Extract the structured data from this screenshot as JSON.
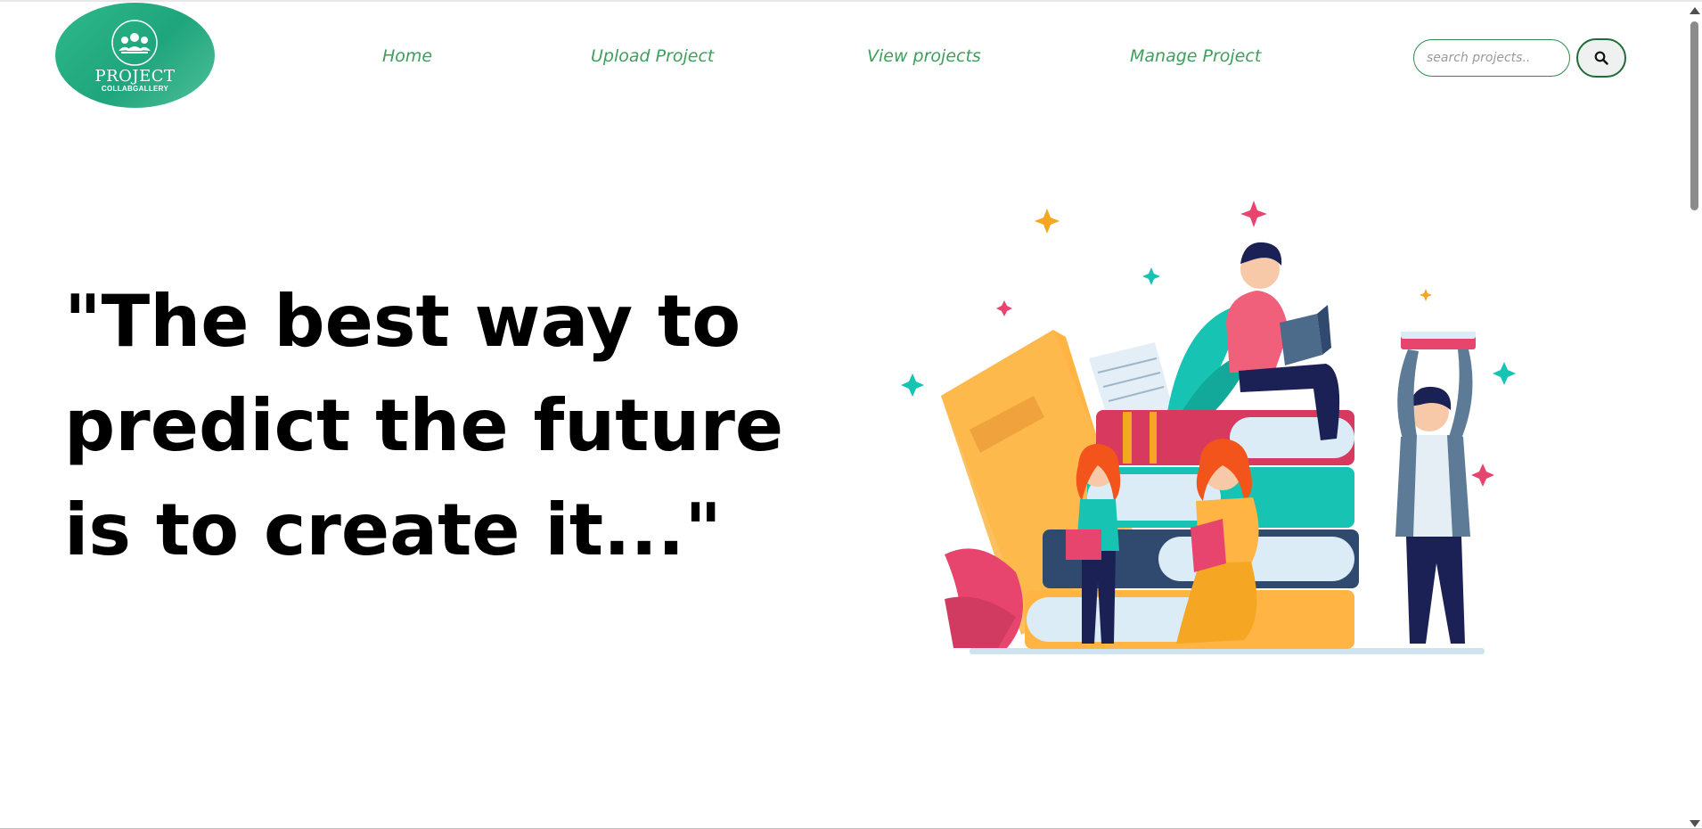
{
  "header": {
    "logo": {
      "line1": "PROJECT",
      "line2": "COLLABGALLERY"
    },
    "nav": [
      {
        "label": "Home"
      },
      {
        "label": "Upload Project"
      },
      {
        "label": "View projects"
      },
      {
        "label": "Manage Project"
      }
    ],
    "search": {
      "placeholder": "search projects..",
      "icon": "search-icon"
    }
  },
  "hero": {
    "quote": "\"The best way to predict the future is to create it...\"",
    "illustration": "people-reading-books-illustration"
  },
  "colors": {
    "logo_green": "#2eb98a",
    "nav_text": "#3f9e5c",
    "search_border": "#2f8a4d",
    "search_button_border": "#206b3a"
  }
}
